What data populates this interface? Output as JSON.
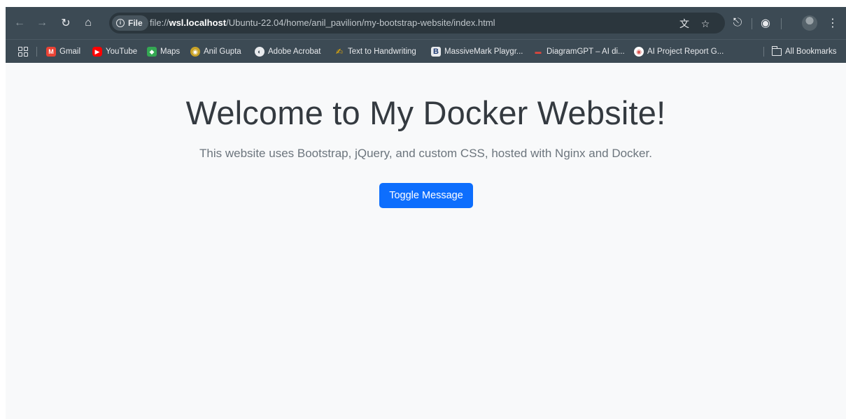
{
  "browser": {
    "url_chip": "File",
    "url_prefix": "file://",
    "url_host": "wsl.localhost",
    "url_path": "/Ubuntu-22.04/home/anil_pavilion/my-bootstrap-website/index.html",
    "icons": {
      "back": "arrow-left-icon",
      "forward": "arrow-right-icon",
      "reload": "reload-icon",
      "home": "home-icon",
      "translate": "translate-icon",
      "star": "star-icon",
      "extensions": "puzzle-icon",
      "lens": "lens-icon",
      "menu": "kebab-menu-icon"
    }
  },
  "bookmarks": {
    "items": [
      {
        "label": "Gmail",
        "color": "#ea4335",
        "glyph": "M"
      },
      {
        "label": "YouTube",
        "color": "#ff0000",
        "glyph": "▶"
      },
      {
        "label": "Maps",
        "color": "#34a853",
        "glyph": "◆"
      },
      {
        "label": "Anil Gupta",
        "color": "#c9a227",
        "glyph": "◉"
      },
      {
        "label": "Adobe Acrobat",
        "color": "#3c4a54",
        "glyph": "◐"
      },
      {
        "label": "Text to Handwriting",
        "color": "#f4b400",
        "glyph": "✍"
      },
      {
        "label": "MassiveMark Playgr...",
        "color": "#1f3b73",
        "glyph": "B"
      },
      {
        "label": "DiagramGPT – AI di...",
        "color": "#e0463c",
        "glyph": "▬"
      },
      {
        "label": "AI Project Report G...",
        "color": "#d9534f",
        "glyph": "◉"
      }
    ],
    "all_bookmarks": "All Bookmarks"
  },
  "page": {
    "heading": "Welcome to My Docker Website!",
    "lead": "This website uses Bootstrap, jQuery, and custom CSS, hosted with Nginx and Docker.",
    "button_label": "Toggle Message",
    "accent": "#0d6efd"
  }
}
